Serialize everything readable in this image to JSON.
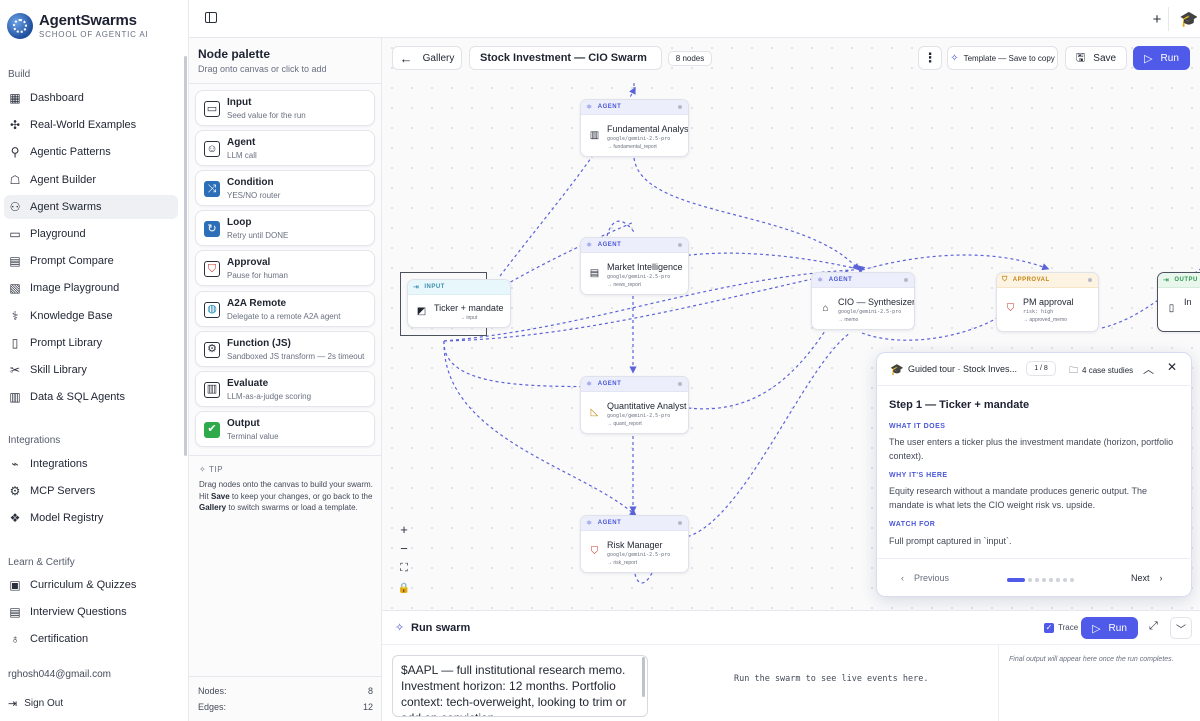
{
  "brand": {
    "name": "AgentSwarms",
    "subtitle": "SCHOOL OF AGENTIC AI"
  },
  "sidebar": {
    "sections": [
      {
        "label": "Build"
      },
      {
        "label": "Integrations"
      },
      {
        "label": "Learn & Certify"
      }
    ],
    "build_items": [
      {
        "label": "Dashboard",
        "icon": "grid-icon"
      },
      {
        "label": "Real-World Examples",
        "icon": "puzzle-icon"
      },
      {
        "label": "Agentic Patterns",
        "icon": "nodes-icon"
      },
      {
        "label": "Agent Builder",
        "icon": "bot-icon"
      },
      {
        "label": "Agent Swarms",
        "icon": "swarm-icon",
        "active": true
      },
      {
        "label": "Playground",
        "icon": "chat-icon"
      },
      {
        "label": "Prompt Compare",
        "icon": "compare-icon"
      },
      {
        "label": "Image Playground",
        "icon": "image-icon"
      },
      {
        "label": "Knowledge Base",
        "icon": "brain-icon"
      },
      {
        "label": "Prompt Library",
        "icon": "book-icon"
      },
      {
        "label": "Skill Library",
        "icon": "tools-icon"
      },
      {
        "label": "Data & SQL Agents",
        "icon": "database-icon"
      }
    ],
    "integration_items": [
      {
        "label": "Integrations",
        "icon": "plug-icon"
      },
      {
        "label": "MCP Servers",
        "icon": "server-icon"
      },
      {
        "label": "Model Registry",
        "icon": "cube-icon"
      }
    ],
    "learn_items": [
      {
        "label": "Curriculum & Quizzes",
        "icon": "graduation-icon"
      },
      {
        "label": "Interview Questions",
        "icon": "clipboard-icon"
      },
      {
        "label": "Certification",
        "icon": "award-icon"
      }
    ],
    "user_email": "rghosh044@gmail.com",
    "sign_out": "Sign Out"
  },
  "palette": {
    "title": "Node palette",
    "subtitle": "Drag onto canvas or click to add",
    "items": [
      {
        "name": "Input",
        "desc": "Seed value for the run",
        "icon": "input-icon",
        "glyph": "▭",
        "bg": "#ffffff",
        "color": "#2a2f3c"
      },
      {
        "name": "Agent",
        "desc": "LLM call",
        "icon": "robot-icon",
        "glyph": "☺",
        "bg": "#ffffff",
        "color": "#2a2f3c"
      },
      {
        "name": "Condition",
        "desc": "YES/NO router",
        "icon": "shuffle-icon",
        "glyph": "⤨",
        "bg": "#2c6fb8",
        "color": "#ffffff"
      },
      {
        "name": "Loop",
        "desc": "Retry until DONE",
        "icon": "repeat-icon",
        "glyph": "↻",
        "bg": "#2c6fb8",
        "color": "#ffffff"
      },
      {
        "name": "Approval",
        "desc": "Pause for human",
        "icon": "shield-icon",
        "glyph": "⛉",
        "bg": "#ffffff",
        "color": "#c0392b"
      },
      {
        "name": "A2A Remote",
        "desc": "Delegate to a remote A2A agent",
        "icon": "globe-icon",
        "glyph": "◍",
        "bg": "#ffffff",
        "color": "#1e88b6"
      },
      {
        "name": "Function (JS)",
        "desc": "Sandboxed JS transform — 2s timeout",
        "icon": "gear-icon",
        "glyph": "⚙",
        "bg": "#ffffff",
        "color": "#2a2f3c"
      },
      {
        "name": "Evaluate",
        "desc": "LLM-as-a-judge scoring",
        "icon": "bar-chart-icon",
        "glyph": "▥",
        "bg": "#ffffff",
        "color": "#2a2f3c"
      },
      {
        "name": "Output",
        "desc": "Terminal value",
        "icon": "check-icon",
        "glyph": "✔",
        "bg": "#2eaa4a",
        "color": "#ffffff"
      }
    ],
    "tip_label": "TIP",
    "tip_text_a": "Drag nodes onto the canvas to build your swarm. Hit ",
    "tip_bold_a": "Save",
    "tip_text_b": " to keep your changes, or go back to the ",
    "tip_bold_b": "Gallery",
    "tip_text_c": " to switch swarms or load a template.",
    "nodes_label": "Nodes:",
    "nodes_value": "8",
    "edges_label": "Edges:",
    "edges_value": "12"
  },
  "toolbar": {
    "gallery": "Gallery",
    "swarm_name": "Stock Investment — CIO Swarm",
    "node_count": "8 nodes",
    "template": "Template — Save to copy",
    "save": "Save",
    "run": "Run"
  },
  "nodes": {
    "fundamental": {
      "kind": "AGENT",
      "title": "Fundamental Analyst",
      "model": "google/gemini-2.5-pro",
      "out": "→ fundamental_report",
      "glyph": "▥"
    },
    "market": {
      "kind": "AGENT",
      "title": "Market Intelligence",
      "model": "google/gemini-2.5-pro",
      "out": "→ news_report",
      "glyph": "▤"
    },
    "quant": {
      "kind": "AGENT",
      "title": "Quantitative Analyst",
      "model": "google/gemini-2.5-pro",
      "out": "→ quant_report",
      "glyph": "◺"
    },
    "risk": {
      "kind": "AGENT",
      "title": "Risk Manager",
      "model": "google/gemini-2.5-pro",
      "out": "→ risk_report",
      "glyph": "⛉"
    },
    "input": {
      "kind": "INPUT",
      "title": "Ticker + mandate",
      "out": "→ input",
      "glyph": "◩"
    },
    "cio": {
      "kind": "AGENT",
      "title": "CIO — Synthesizer",
      "model": "google/gemini-2.5-pro",
      "out": "→ memo",
      "glyph": "⌂"
    },
    "pm": {
      "kind": "APPROVAL",
      "title": "PM approval",
      "model": "risk: high",
      "out": "→ approved_memo",
      "glyph": "⛉"
    },
    "output": {
      "kind": "OUTPU",
      "title": "In",
      "glyph": "▯"
    }
  },
  "tour": {
    "title": "Guided tour · Stock Inves...",
    "counter": "1 / 8",
    "cases": "4 case studies",
    "step": "Step 1 — Ticker + mandate",
    "what_label": "WHAT IT DOES",
    "what_text": "The user enters a ticker plus the investment mandate (horizon, portfolio context).",
    "why_label": "WHY IT'S HERE",
    "why_text": "Equity research without a mandate produces generic output. The mandate is what lets the CIO weight risk vs. upside.",
    "watch_label": "WATCH FOR",
    "watch_text": "Full prompt captured in `input`.",
    "prev": "Previous",
    "next": "Next"
  },
  "run_panel": {
    "title": "Run swarm",
    "trace": "Trace",
    "run": "Run",
    "prompt": "$AAPL — full institutional research memo. Investment horizon: 12 months. Portfolio context: tech-overweight, looking to trim or add on conviction.",
    "events_msg": "Run the swarm to see live events here.",
    "final_msg": "Final output will appear here once the run completes."
  },
  "colors": {
    "accent": "#4f5be8",
    "edge": "#5b63d9"
  }
}
